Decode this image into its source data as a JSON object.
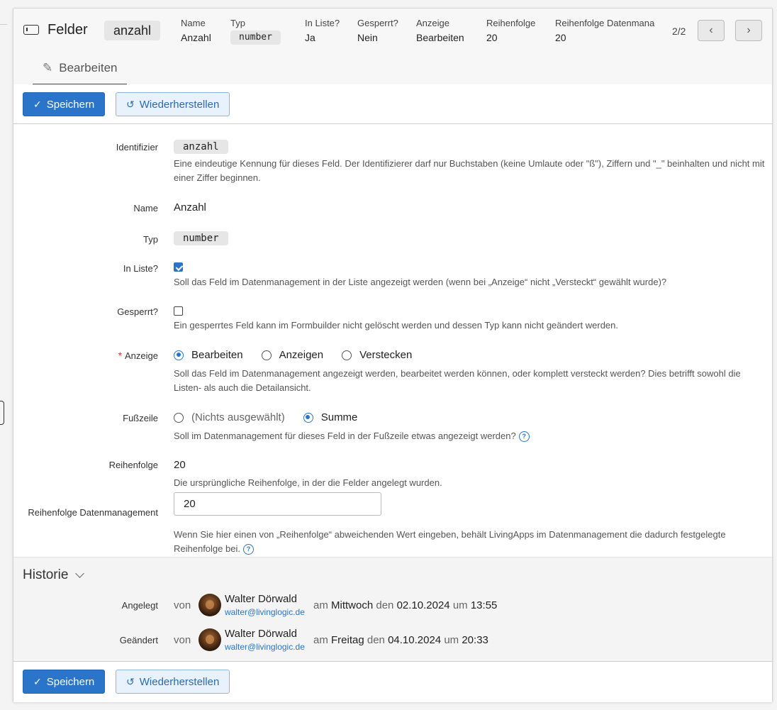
{
  "header": {
    "title": "Felder",
    "identifier_badge": "anzahl",
    "meta": [
      {
        "label": "Name",
        "value": "Anzahl"
      },
      {
        "label": "Typ",
        "value": "number"
      },
      {
        "label": "In Liste?",
        "value": "Ja"
      },
      {
        "label": "Gesperrt?",
        "value": "Nein"
      },
      {
        "label": "Anzeige",
        "value": "Bearbeiten"
      },
      {
        "label": "Reihenfolge",
        "value": "20"
      },
      {
        "label": "Reihenfolge Datenmanagement",
        "value": "20"
      }
    ],
    "pager": "2/2"
  },
  "tabs": [
    {
      "label": "Bearbeiten",
      "icon": "pencil-icon"
    }
  ],
  "buttons": {
    "save": "Speichern",
    "restore": "Wiederherstellen"
  },
  "form": {
    "identifier": {
      "label": "Identifizier",
      "value": "anzahl",
      "help": "Eine eindeutige Kennung für dieses Feld. Der Identifizierer darf nur Buchstaben (keine Umlaute oder \"ß\"), Ziffern und \"_\" beinhalten und nicht mit einer Ziffer beginnen."
    },
    "name": {
      "label": "Name",
      "value": "Anzahl"
    },
    "type": {
      "label": "Typ",
      "value": "number"
    },
    "in_list": {
      "label": "In Liste?",
      "checked": true,
      "help": "Soll das Feld im Datenmanagement in der Liste angezeigt werden (wenn bei „Anzeige“ nicht „Versteckt“ gewählt wurde)?"
    },
    "locked": {
      "label": "Gesperrt?",
      "checked": false,
      "help": "Ein gesperrtes Feld kann im Formbuilder nicht gelöscht werden und dessen Typ kann nicht geändert werden."
    },
    "display": {
      "required_mark": "*",
      "label": "Anzeige",
      "options": [
        "Bearbeiten",
        "Anzeigen",
        "Verstecken"
      ],
      "selected": "Bearbeiten",
      "help": "Soll das Feld im Datenmanagement angezeigt werden, bearbeitet werden können, oder komplett versteckt werden? Dies betrifft sowohl die Listen- als auch die Detailansicht."
    },
    "footer_row": {
      "label": "Fußzeile",
      "options": [
        "(Nichts ausgewählt)",
        "Summe"
      ],
      "selected": "Summe",
      "help": "Soll im Datenmanagement für dieses Feld in der Fußzeile etwas angezeigt werden?"
    },
    "order": {
      "label": "Reihenfolge",
      "value": "20",
      "help": "Die ursprüngliche Reihenfolge, in der die Felder angelegt wurden."
    },
    "order_dm": {
      "label": "Reihenfolge Datenmanagement",
      "value": "20",
      "help": "Wenn Sie hier einen von „Reihenfolge“ abweichenden Wert eingeben, behält LivingApps im Datenmanagement die dadurch festgelegte Reihenfolge bei."
    }
  },
  "history": {
    "title": "Historie",
    "entries": [
      {
        "label": "Angelegt",
        "von": "von",
        "user": "Walter Dörwald",
        "email": "walter@livinglogic.de",
        "am": "am",
        "weekday": "Mittwoch",
        "den": "den",
        "date": "02.10.2024",
        "um": "um",
        "time": "13:55"
      },
      {
        "label": "Geändert",
        "von": "von",
        "user": "Walter Dörwald",
        "email": "walter@livinglogic.de",
        "am": "am",
        "weekday": "Freitag",
        "den": "den",
        "date": "04.10.2024",
        "um": "um",
        "time": "20:33"
      }
    ]
  },
  "colors": {
    "accent": "#2a74c9",
    "required": "#d33333"
  }
}
